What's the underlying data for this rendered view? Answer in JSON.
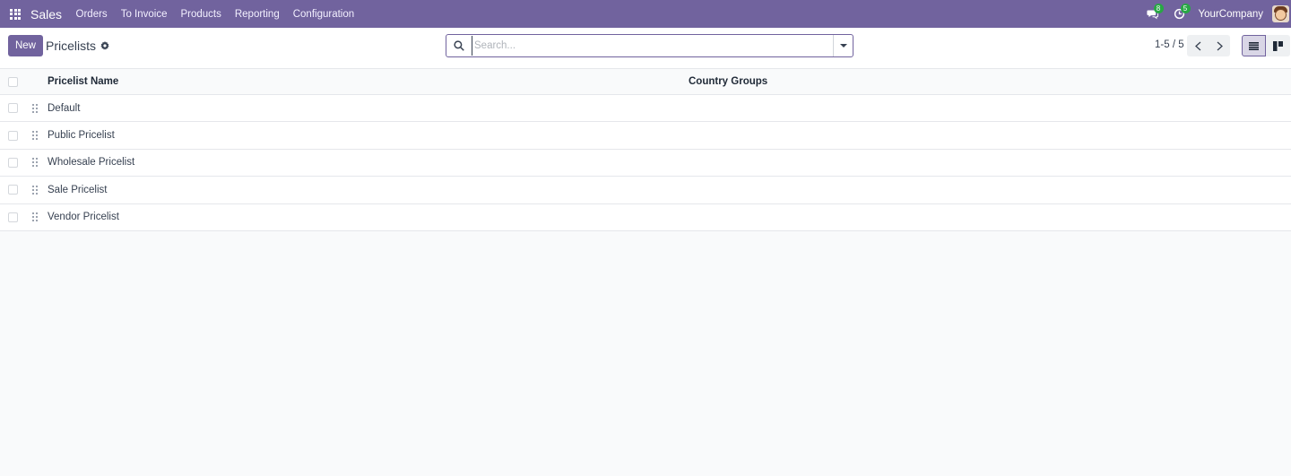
{
  "navbar": {
    "app_name": "Sales",
    "menu": [
      "Orders",
      "To Invoice",
      "Products",
      "Reporting",
      "Configuration"
    ],
    "messages_count": "8",
    "activities_count": "5",
    "company": "YourCompany"
  },
  "control_panel": {
    "new_label": "New",
    "title": "Pricelists",
    "search_placeholder": "Search...",
    "pager_text": "1-5 / 5"
  },
  "table": {
    "columns": [
      "Pricelist Name",
      "Country Groups"
    ],
    "rows": [
      {
        "name": "Default",
        "country_groups": ""
      },
      {
        "name": "Public Pricelist",
        "country_groups": ""
      },
      {
        "name": "Wholesale Pricelist",
        "country_groups": ""
      },
      {
        "name": "Sale Pricelist",
        "country_groups": ""
      },
      {
        "name": "Vendor Pricelist",
        "country_groups": ""
      }
    ]
  },
  "colors": {
    "brand": "#71639e",
    "badge": "#28a745"
  }
}
